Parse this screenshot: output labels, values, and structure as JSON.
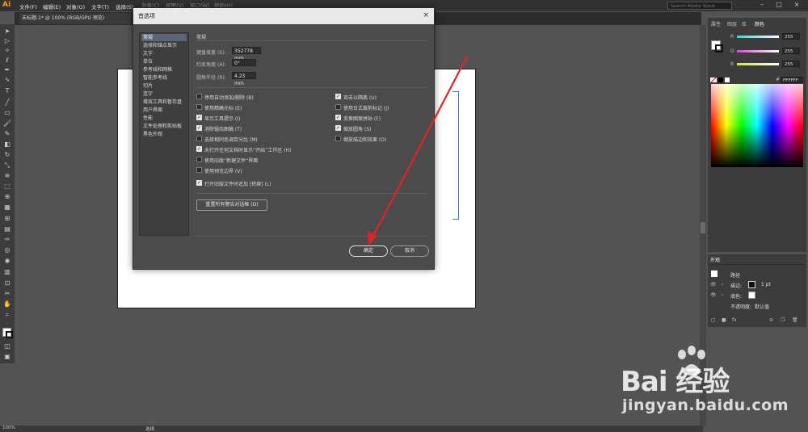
{
  "menubar": {
    "logo": "Ai",
    "items": [
      "文件(F)",
      "编辑(E)",
      "对象(O)",
      "文字(T)",
      "选择(S)",
      "效果(C)",
      "视图(V)",
      "窗口(W)",
      "帮助(H)"
    ],
    "search_placeholder": "Search Adobe Stock"
  },
  "document_tab": {
    "label": "未标题-1* @ 100% (RGB/GPU 预览)",
    "close": "×"
  },
  "status": {
    "zoom": "100%",
    "tool": "选择"
  },
  "dialog": {
    "title": "首选项",
    "categories": [
      "常规",
      "选择和锚点显示",
      "文字",
      "单位",
      "参考线和网格",
      "智能参考线",
      "切片",
      "连字",
      "增效工具和暂存盘",
      "用户界面",
      "性能",
      "文件处理和剪贴板",
      "黑色外观"
    ],
    "selected_category": "常规",
    "section_title": "常规",
    "fields": [
      {
        "label": "键盘增量 (K):",
        "value": "352778 mm"
      },
      {
        "label": "约束角度 (A):",
        "value": "0°"
      },
      {
        "label": "圆角半径 (R):",
        "value": "4.23 mm"
      }
    ],
    "left_options": [
      {
        "label": "停用自动添加/删除 (B)",
        "checked": false
      },
      {
        "label": "使用精确光标 (E)",
        "checked": false
      },
      {
        "label": "显示工具提示 (I)",
        "checked": true
      },
      {
        "label": "消除锯齿图稿 (T)",
        "checked": true
      },
      {
        "label": "选择相同色调百分比 (M)",
        "checked": false
      },
      {
        "label": "未打开任何文档时显示“开始”工作区 (H)",
        "checked": true
      },
      {
        "label": "使用旧版“新建文件”界面",
        "checked": false
      },
      {
        "label": "使用预览边界 (V)",
        "checked": false
      },
      {
        "label": "打开旧版文件时追加 [转换] (L)",
        "checked": true
      }
    ],
    "right_options": [
      {
        "label": "双击以隔离 (U)",
        "checked": true
      },
      {
        "label": "使用日式裁剪标记 (J)",
        "checked": false
      },
      {
        "label": "变换图案拼贴 (F)",
        "checked": true
      },
      {
        "label": "缩放圆角 (S)",
        "checked": true
      },
      {
        "label": "缩放描边和效果 (O)",
        "checked": false
      }
    ],
    "reset_button": "重置所有警告对话框 (D)",
    "ok_button": "确定",
    "cancel_button": "取消"
  },
  "color_panel": {
    "tabs": [
      "属性",
      "图层",
      "库",
      "颜色"
    ],
    "active_tab": "颜色",
    "channels": [
      {
        "name": "R",
        "value": "255",
        "color": "#ff3b3b"
      },
      {
        "name": "G",
        "value": "255",
        "color": "#3bff3b"
      },
      {
        "name": "B",
        "value": "255",
        "color": "#3b3bff"
      }
    ],
    "hex_prefix": "#",
    "hex": "FFFFFF"
  },
  "appearance_panel": {
    "title": "外观",
    "object": "路径",
    "stroke_label": "描边:",
    "stroke_value": "1 pt",
    "fill_label": "填色:",
    "opacity_label": "不透明度:",
    "opacity_value": "默认值"
  },
  "watermark": {
    "brand": "Bai 经验",
    "url": "jingyan.baidu.com"
  },
  "colors": {
    "accent": "#e32323",
    "selection": "#3d6fd8"
  }
}
